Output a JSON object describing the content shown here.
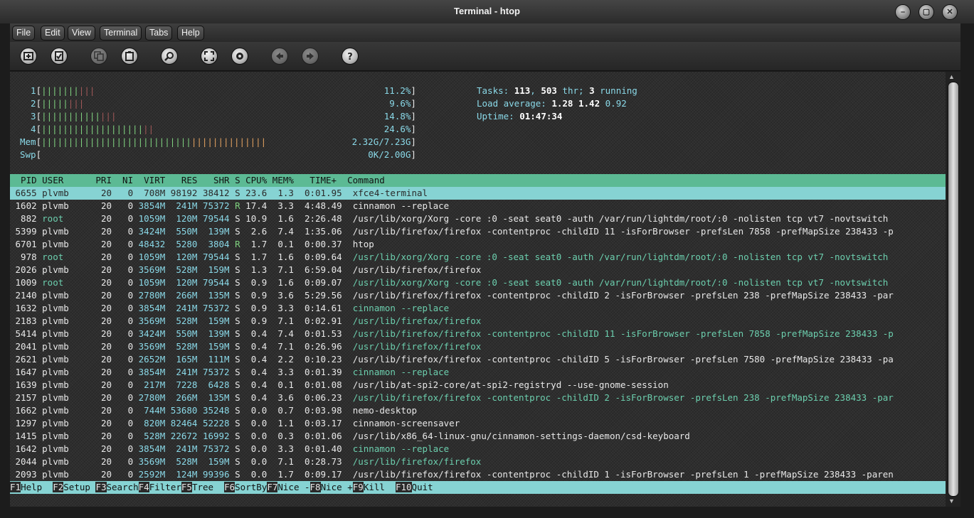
{
  "window": {
    "title": "Terminal - htop"
  },
  "menu": [
    "File",
    "Edit",
    "View",
    "Terminal",
    "Tabs",
    "Help"
  ],
  "toolbar_icons": [
    "new-tab-icon",
    "new-window-icon",
    "copy-icon",
    "paste-icon",
    "search-icon",
    "fullscreen-icon",
    "settings-icon",
    "back-icon",
    "forward-icon",
    "help-icon"
  ],
  "meters": [
    {
      "label": "1",
      "bars_green": 7,
      "bars_red": 3,
      "value": "11.2%"
    },
    {
      "label": "2",
      "bars_green": 5,
      "bars_red": 3,
      "value": "9.6%"
    },
    {
      "label": "3",
      "bars_green": 11,
      "bars_red": 3,
      "value": "14.8%"
    },
    {
      "label": "4",
      "bars_green": 19,
      "bars_red": 2,
      "value": "24.6%"
    },
    {
      "label": "Mem",
      "bars_green": 28,
      "bars_orange": 14,
      "value": "2.32G/7.23G"
    },
    {
      "label": "Swp",
      "bars_green": 0,
      "value": "0K/2.00G"
    }
  ],
  "summary": {
    "tasks_label": "Tasks: ",
    "tasks": "113",
    "thr_sep": ", ",
    "thr": "503",
    "thr_label": " thr; ",
    "running": "3",
    "running_label": " running",
    "load_label": "Load average: ",
    "load1": "1.28",
    "load5": "1.42",
    "load15": "0.92",
    "uptime_label": "Uptime: ",
    "uptime": "01:47:34"
  },
  "columns": "  PID USER      PRI  NI  VIRT   RES   SHR S CPU% MEM%   TIME+  Command",
  "processes": [
    {
      "pid": "6655",
      "user": "plvmb",
      "pri": "20",
      "ni": "0",
      "virt": "708M",
      "res": "98192",
      "shr": "38412",
      "s": "S",
      "cpu": "23.6",
      "mem": "1.3",
      "time": "0:01.95",
      "cmd": "xfce4-terminal",
      "thread": false,
      "sel": true
    },
    {
      "pid": "1602",
      "user": "plvmb",
      "pri": "20",
      "ni": "0",
      "virt": "3854M",
      "res": "241M",
      "shr": "75372",
      "s": "R",
      "cpu": "17.4",
      "mem": "3.3",
      "time": "4:48.49",
      "cmd": "cinnamon --replace",
      "thread": false
    },
    {
      "pid": "882",
      "user": "root",
      "pri": "20",
      "ni": "0",
      "virt": "1059M",
      "res": "120M",
      "shr": "79544",
      "s": "S",
      "cpu": "10.9",
      "mem": "1.6",
      "time": "2:26.48",
      "cmd": "/usr/lib/xorg/Xorg -core :0 -seat seat0 -auth /var/run/lightdm/root/:0 -nolisten tcp vt7 -novtswitch",
      "thread": false
    },
    {
      "pid": "5399",
      "user": "plvmb",
      "pri": "20",
      "ni": "0",
      "virt": "3424M",
      "res": "550M",
      "shr": "139M",
      "s": "S",
      "cpu": "2.6",
      "mem": "7.4",
      "time": "1:35.06",
      "cmd": "/usr/lib/firefox/firefox -contentproc -childID 11 -isForBrowser -prefsLen 7858 -prefMapSize 238433 -p",
      "thread": false
    },
    {
      "pid": "6701",
      "user": "plvmb",
      "pri": "20",
      "ni": "0",
      "virt": "48432",
      "res": "5280",
      "shr": "3804",
      "s": "R",
      "cpu": "1.7",
      "mem": "0.1",
      "time": "0:00.37",
      "cmd": "htop",
      "thread": false
    },
    {
      "pid": "978",
      "user": "root",
      "pri": "20",
      "ni": "0",
      "virt": "1059M",
      "res": "120M",
      "shr": "79544",
      "s": "S",
      "cpu": "1.7",
      "mem": "1.6",
      "time": "0:09.64",
      "cmd": "/usr/lib/xorg/Xorg -core :0 -seat seat0 -auth /var/run/lightdm/root/:0 -nolisten tcp vt7 -novtswitch",
      "thread": true
    },
    {
      "pid": "2026",
      "user": "plvmb",
      "pri": "20",
      "ni": "0",
      "virt": "3569M",
      "res": "528M",
      "shr": "159M",
      "s": "S",
      "cpu": "1.3",
      "mem": "7.1",
      "time": "6:59.04",
      "cmd": "/usr/lib/firefox/firefox",
      "thread": false
    },
    {
      "pid": "1009",
      "user": "root",
      "pri": "20",
      "ni": "0",
      "virt": "1059M",
      "res": "120M",
      "shr": "79544",
      "s": "S",
      "cpu": "0.9",
      "mem": "1.6",
      "time": "0:09.07",
      "cmd": "/usr/lib/xorg/Xorg -core :0 -seat seat0 -auth /var/run/lightdm/root/:0 -nolisten tcp vt7 -novtswitch",
      "thread": true
    },
    {
      "pid": "2140",
      "user": "plvmb",
      "pri": "20",
      "ni": "0",
      "virt": "2780M",
      "res": "266M",
      "shr": "135M",
      "s": "S",
      "cpu": "0.9",
      "mem": "3.6",
      "time": "5:29.56",
      "cmd": "/usr/lib/firefox/firefox -contentproc -childID 2 -isForBrowser -prefsLen 238 -prefMapSize 238433 -par",
      "thread": false
    },
    {
      "pid": "1632",
      "user": "plvmb",
      "pri": "20",
      "ni": "0",
      "virt": "3854M",
      "res": "241M",
      "shr": "75372",
      "s": "S",
      "cpu": "0.9",
      "mem": "3.3",
      "time": "0:14.61",
      "cmd": "cinnamon --replace",
      "thread": true
    },
    {
      "pid": "2183",
      "user": "plvmb",
      "pri": "20",
      "ni": "0",
      "virt": "3569M",
      "res": "528M",
      "shr": "159M",
      "s": "S",
      "cpu": "0.9",
      "mem": "7.1",
      "time": "0:02.91",
      "cmd": "/usr/lib/firefox/firefox",
      "thread": true
    },
    {
      "pid": "5414",
      "user": "plvmb",
      "pri": "20",
      "ni": "0",
      "virt": "3424M",
      "res": "550M",
      "shr": "139M",
      "s": "S",
      "cpu": "0.4",
      "mem": "7.4",
      "time": "0:01.53",
      "cmd": "/usr/lib/firefox/firefox -contentproc -childID 11 -isForBrowser -prefsLen 7858 -prefMapSize 238433 -p",
      "thread": true
    },
    {
      "pid": "2041",
      "user": "plvmb",
      "pri": "20",
      "ni": "0",
      "virt": "3569M",
      "res": "528M",
      "shr": "159M",
      "s": "S",
      "cpu": "0.4",
      "mem": "7.1",
      "time": "0:26.96",
      "cmd": "/usr/lib/firefox/firefox",
      "thread": true
    },
    {
      "pid": "2621",
      "user": "plvmb",
      "pri": "20",
      "ni": "0",
      "virt": "2652M",
      "res": "165M",
      "shr": "111M",
      "s": "S",
      "cpu": "0.4",
      "mem": "2.2",
      "time": "0:10.23",
      "cmd": "/usr/lib/firefox/firefox -contentproc -childID 5 -isForBrowser -prefsLen 7580 -prefMapSize 238433 -pa",
      "thread": false
    },
    {
      "pid": "1647",
      "user": "plvmb",
      "pri": "20",
      "ni": "0",
      "virt": "3854M",
      "res": "241M",
      "shr": "75372",
      "s": "S",
      "cpu": "0.4",
      "mem": "3.3",
      "time": "0:01.39",
      "cmd": "cinnamon --replace",
      "thread": true
    },
    {
      "pid": "1639",
      "user": "plvmb",
      "pri": "20",
      "ni": "0",
      "virt": "217M",
      "res": "7228",
      "shr": "6428",
      "s": "S",
      "cpu": "0.4",
      "mem": "0.1",
      "time": "0:01.08",
      "cmd": "/usr/lib/at-spi2-core/at-spi2-registryd --use-gnome-session",
      "thread": false
    },
    {
      "pid": "2157",
      "user": "plvmb",
      "pri": "20",
      "ni": "0",
      "virt": "2780M",
      "res": "266M",
      "shr": "135M",
      "s": "S",
      "cpu": "0.4",
      "mem": "3.6",
      "time": "0:06.23",
      "cmd": "/usr/lib/firefox/firefox -contentproc -childID 2 -isForBrowser -prefsLen 238 -prefMapSize 238433 -par",
      "thread": true
    },
    {
      "pid": "1662",
      "user": "plvmb",
      "pri": "20",
      "ni": "0",
      "virt": "744M",
      "res": "53680",
      "shr": "35248",
      "s": "S",
      "cpu": "0.0",
      "mem": "0.7",
      "time": "0:03.98",
      "cmd": "nemo-desktop",
      "thread": false
    },
    {
      "pid": "1297",
      "user": "plvmb",
      "pri": "20",
      "ni": "0",
      "virt": "820M",
      "res": "82464",
      "shr": "52228",
      "s": "S",
      "cpu": "0.0",
      "mem": "1.1",
      "time": "0:03.17",
      "cmd": "cinnamon-screensaver",
      "thread": false
    },
    {
      "pid": "1415",
      "user": "plvmb",
      "pri": "20",
      "ni": "0",
      "virt": "528M",
      "res": "22672",
      "shr": "16992",
      "s": "S",
      "cpu": "0.0",
      "mem": "0.3",
      "time": "0:01.06",
      "cmd": "/usr/lib/x86_64-linux-gnu/cinnamon-settings-daemon/csd-keyboard",
      "thread": false
    },
    {
      "pid": "1642",
      "user": "plvmb",
      "pri": "20",
      "ni": "0",
      "virt": "3854M",
      "res": "241M",
      "shr": "75372",
      "s": "S",
      "cpu": "0.0",
      "mem": "3.3",
      "time": "0:01.40",
      "cmd": "cinnamon --replace",
      "thread": true
    },
    {
      "pid": "2044",
      "user": "plvmb",
      "pri": "20",
      "ni": "0",
      "virt": "3569M",
      "res": "528M",
      "shr": "159M",
      "s": "S",
      "cpu": "0.0",
      "mem": "7.1",
      "time": "0:28.73",
      "cmd": "/usr/lib/firefox/firefox",
      "thread": true
    },
    {
      "pid": "2093",
      "user": "plvmb",
      "pri": "20",
      "ni": "0",
      "virt": "2592M",
      "res": "124M",
      "shr": "99396",
      "s": "S",
      "cpu": "0.0",
      "mem": "1.7",
      "time": "0:09.17",
      "cmd": "/usr/lib/firefox/firefox -contentproc -childID 1 -isForBrowser -prefsLen 1 -prefMapSize 238433 -paren",
      "thread": false
    }
  ],
  "fkeys": [
    {
      "key": "F1",
      "label": "Help  "
    },
    {
      "key": "F2",
      "label": "Setup "
    },
    {
      "key": "F3",
      "label": "Search"
    },
    {
      "key": "F4",
      "label": "Filter"
    },
    {
      "key": "F5",
      "label": "Tree  "
    },
    {
      "key": "F6",
      "label": "SortBy"
    },
    {
      "key": "F7",
      "label": "Nice -"
    },
    {
      "key": "F8",
      "label": "Nice +"
    },
    {
      "key": "F9",
      "label": "Kill  "
    },
    {
      "key": "F10",
      "label": "Quit"
    }
  ],
  "colors": {
    "header_bg": "#5cba94",
    "selected_bg": "#86d3d3",
    "sort_col_bg": "#8ad9e0",
    "fkey_label_bg": "#86d3d3",
    "terminal_bg": "#2e2e2e"
  }
}
